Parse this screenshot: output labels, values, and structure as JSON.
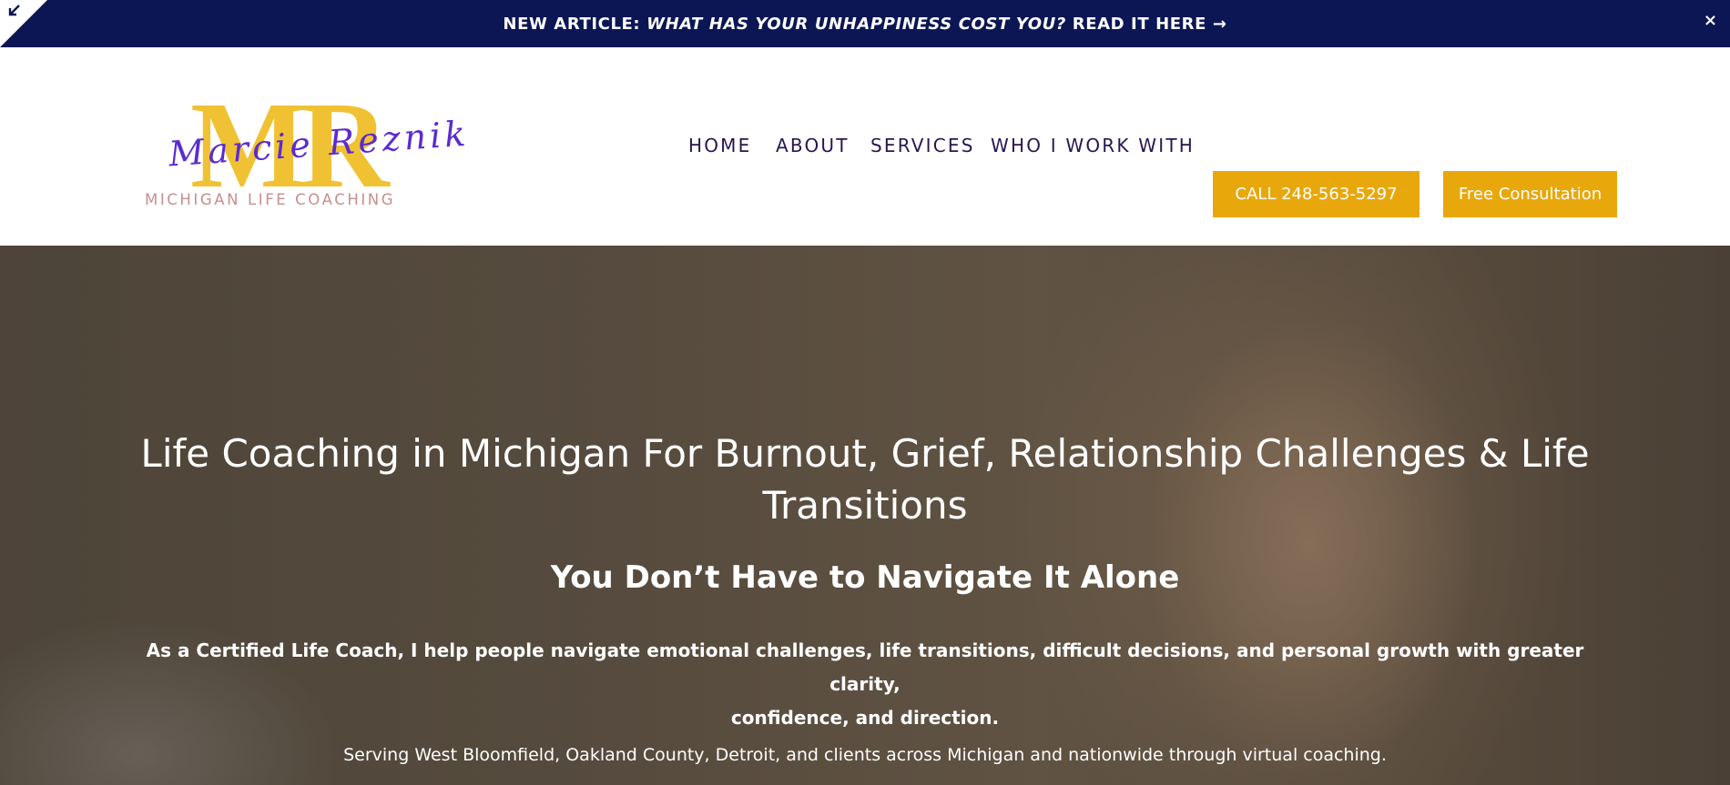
{
  "announcement": {
    "prefix": "NEW ARTICLE: ",
    "article_title": "WHAT HAS YOUR UNHAPPINESS COST YOU?",
    "cta": " READ IT HERE →",
    "close_label": "×"
  },
  "logo": {
    "monogram": "MR",
    "script_name": "Marcie Reznik",
    "tagline": "MICHIGAN LIFE COACHING"
  },
  "nav": {
    "items": [
      {
        "label": "HOME"
      },
      {
        "label": "ABOUT"
      },
      {
        "label": "SERVICES"
      },
      {
        "label": "WHO I WORK WITH"
      }
    ],
    "call_button": "CALL 248-563-5297",
    "consult_button": "Free Consultation"
  },
  "hero": {
    "title_line1": "Life Coaching in Michigan For Burnout, Grief, Relationship Challenges & Life",
    "title_line2": "Transitions",
    "subtitle": "You Don’t Have to Navigate It Alone",
    "body_line1": "As a Certified Life Coach, I help people navigate emotional challenges, life transitions, difficult decisions, and personal growth with greater clarity,",
    "body_line2": "confidence, and direction.",
    "note": "Serving West Bloomfield, Oakland County, Detroit, and clients across Michigan and nationwide through virtual coaching."
  },
  "colors": {
    "announcement_bg": "#0c1654",
    "nav_text": "#2a1550",
    "button_bg": "#e8a80c",
    "logo_gold": "#f0c233",
    "logo_purple": "#5b2bd0",
    "logo_tagline": "#c98e8e"
  },
  "icons": {
    "corner": "collapse-arrow-icon",
    "close": "close-icon"
  }
}
